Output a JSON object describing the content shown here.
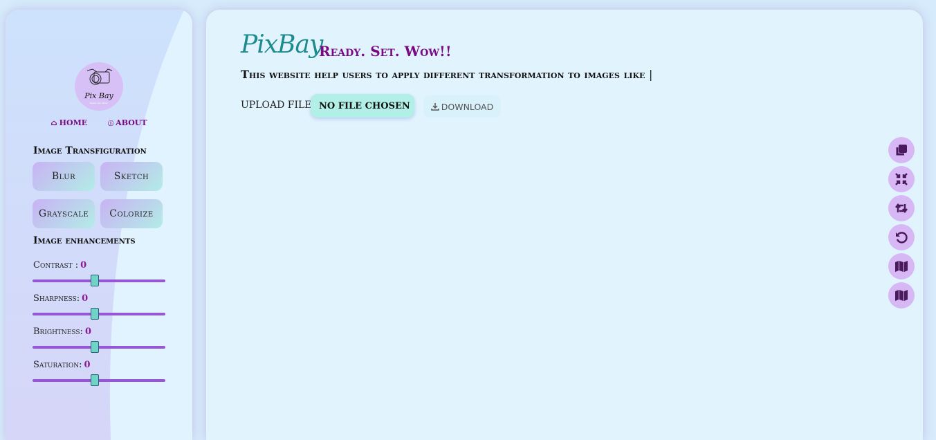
{
  "sidebar": {
    "logo": {
      "text": "Pix Bay",
      "tagline": "Ready. Set. Wow!"
    },
    "nav": [
      {
        "label": "HOME",
        "icon": "home-icon"
      },
      {
        "label": "ABOUT",
        "icon": "info-icon"
      }
    ],
    "transfiguration_title": "Image Transfiguration",
    "transfiguration_buttons": [
      "Blur",
      "Sketch",
      "Grayscale",
      "Colorize"
    ],
    "enhancements_title": "Image enhancements",
    "sliders": [
      {
        "label": "Contrast :",
        "value": "0",
        "fraction": 0.47
      },
      {
        "label": "Sharpness:",
        "value": "0",
        "fraction": 0.47
      },
      {
        "label": "Brightness:",
        "value": "0",
        "fraction": 0.47
      },
      {
        "label": "Saturation:",
        "value": "0",
        "fraction": 0.47
      }
    ]
  },
  "main": {
    "brand": "PixBay",
    "tagline": "Ready. Set. Wow!!",
    "description": "This website help users to apply different transformation to images like",
    "cursor": "|",
    "upload_label": "UPLOAD FILE:",
    "file_button": "NO FILE CHOSEN",
    "download_label": "DOWNLOAD",
    "tools": [
      "copy-icon",
      "compress-icon",
      "retweet-icon",
      "undo-icon",
      "map-icon",
      "map-icon"
    ]
  },
  "colors": {
    "accent": "#7a0a84",
    "brand": "#1d8a8c",
    "slider": "#9657d6",
    "thumb": "#6fd3c6",
    "tool_bg": "#d7b8f5"
  }
}
